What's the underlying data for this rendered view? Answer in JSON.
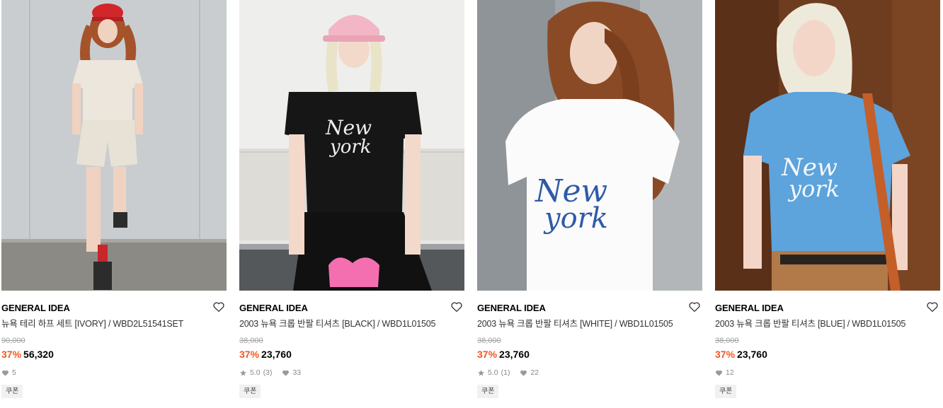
{
  "products": [
    {
      "brand": "GENERAL IDEA",
      "name": "뉴욕 테리 하프 세트 [IVORY] / WBD2L51541SET",
      "original_price": "90,000",
      "discount": "37%",
      "price": "56,320",
      "rating": "",
      "reviews": "",
      "likes": "5",
      "coupon": "쿠폰"
    },
    {
      "brand": "GENERAL IDEA",
      "name": "2003 뉴욕 크롭 반팔 티셔츠 [BLACK] / WBD1L01505",
      "original_price": "38,000",
      "discount": "37%",
      "price": "23,760",
      "rating": "5.0",
      "reviews": "(3)",
      "likes": "33",
      "coupon": "쿠폰"
    },
    {
      "brand": "GENERAL IDEA",
      "name": "2003 뉴욕 크롭 반팔 티셔츠 [WHITE] / WBD1L01505",
      "original_price": "38,000",
      "discount": "37%",
      "price": "23,760",
      "rating": "5.0",
      "reviews": "(1)",
      "likes": "22",
      "coupon": "쿠폰"
    },
    {
      "brand": "GENERAL IDEA",
      "name": "2003 뉴욕 크롭 반팔 티셔츠 [BLUE] / WBD1L01505",
      "original_price": "38,000",
      "discount": "37%",
      "price": "23,760",
      "rating": "",
      "reviews": "",
      "likes": "12",
      "coupon": "쿠폰"
    }
  ],
  "colors": {
    "discount": "#f2571f",
    "strike": "#a0a0a0",
    "coupon_bg": "#f1f1f1"
  },
  "icons": {
    "wishlist": "heart-outline-icon",
    "like": "heart-icon",
    "rating": "star-icon"
  }
}
